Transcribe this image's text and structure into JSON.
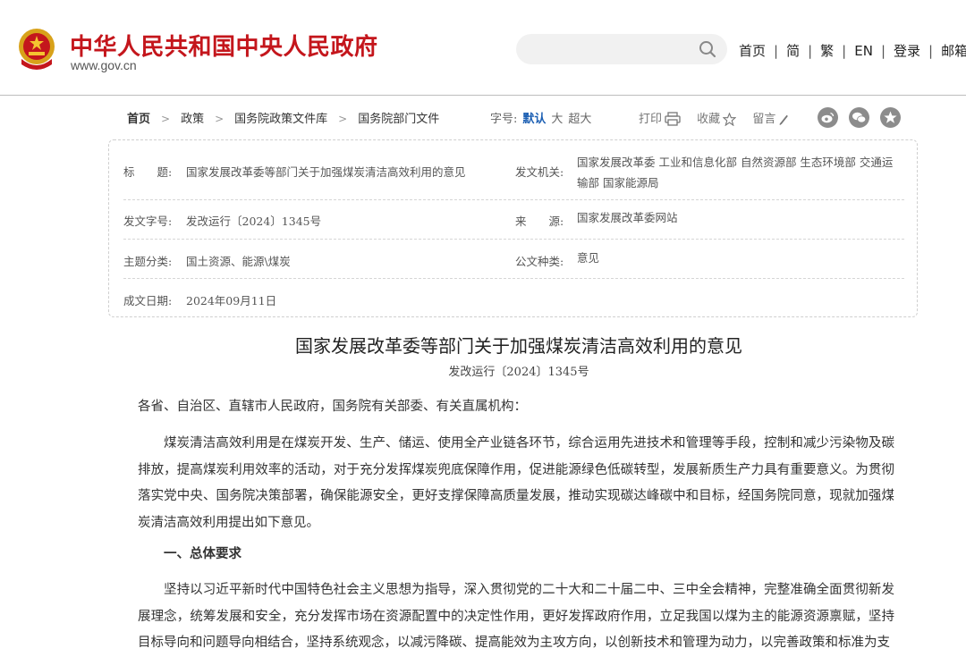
{
  "header": {
    "site_title": "中华人民共和国中央人民政府",
    "site_domain": "www.gov.cn",
    "search": {
      "placeholder": ""
    },
    "nav": [
      "首页",
      "简",
      "繁",
      "EN",
      "登录",
      "邮箱"
    ]
  },
  "breadcrumb": {
    "items": [
      "首页",
      "政策",
      "国务院政策文件库",
      "国务院部门文件"
    ],
    "font_size_label": "字号:",
    "font_sizes": [
      "默认",
      "大",
      "超大"
    ],
    "tools": {
      "print": "打印",
      "favorite": "收藏",
      "comment": "留言"
    },
    "share_icons": [
      "weibo-icon",
      "wechat-icon",
      "star-icon"
    ]
  },
  "meta": {
    "title_label": "标　　题:",
    "title_value": "国家发展改革委等部门关于加强煤炭清洁高效利用的意见",
    "issuer_label": "发文机关:",
    "issuer_value": "国家发展改革委 工业和信息化部 自然资源部 生态环境部 交通运输部 国家能源局",
    "docno_label": "发文字号:",
    "docno_value": "发改运行〔2024〕1345号",
    "source_label": "来　　源:",
    "source_value": "国家发展改革委网站",
    "topic_label": "主题分类:",
    "topic_value": "国土资源、能源\\煤炭",
    "type_label": "公文种类:",
    "type_value": "意见",
    "date_label": "成文日期:",
    "date_value": "2024年09月11日"
  },
  "article": {
    "title": "国家发展改革委等部门关于加强煤炭清洁高效利用的意见",
    "docno": "发改运行〔2024〕1345号",
    "salutation": "各省、自治区、直辖市人民政府，国务院有关部委、有关直属机构：",
    "para1": "煤炭清洁高效利用是在煤炭开发、生产、储运、使用全产业链各环节，综合运用先进技术和管理等手段，控制和减少污染物及碳排放，提高煤炭利用效率的活动，对于充分发挥煤炭兜底保障作用，促进能源绿色低碳转型，发展新质生产力具有重要意义。为贯彻落实党中央、国务院决策部署，确保能源安全，更好支撑保障高质量发展，推动实现碳达峰碳中和目标，经国务院同意，现就加强煤炭清洁高效利用提出如下意见。",
    "section1": "一、总体要求",
    "para2": "坚持以习近平新时代中国特色社会主义思想为指导，深入贯彻党的二十大和二十届二中、三中全会精神，完整准确全面贯彻新发展理念，统筹发展和安全，充分发挥市场在资源配置中的决定性作用，更好发挥政府作用，立足我国以煤为主的能源资源禀赋，坚持目标导向和问题导向相结合，坚持系统观念，以减污降碳、提高能效为主攻方向，以创新技术和管理为动力，以完善政策和标准为支"
  },
  "colors": {
    "brand_red": "#c4161c",
    "link_blue": "#1c5fb3"
  }
}
